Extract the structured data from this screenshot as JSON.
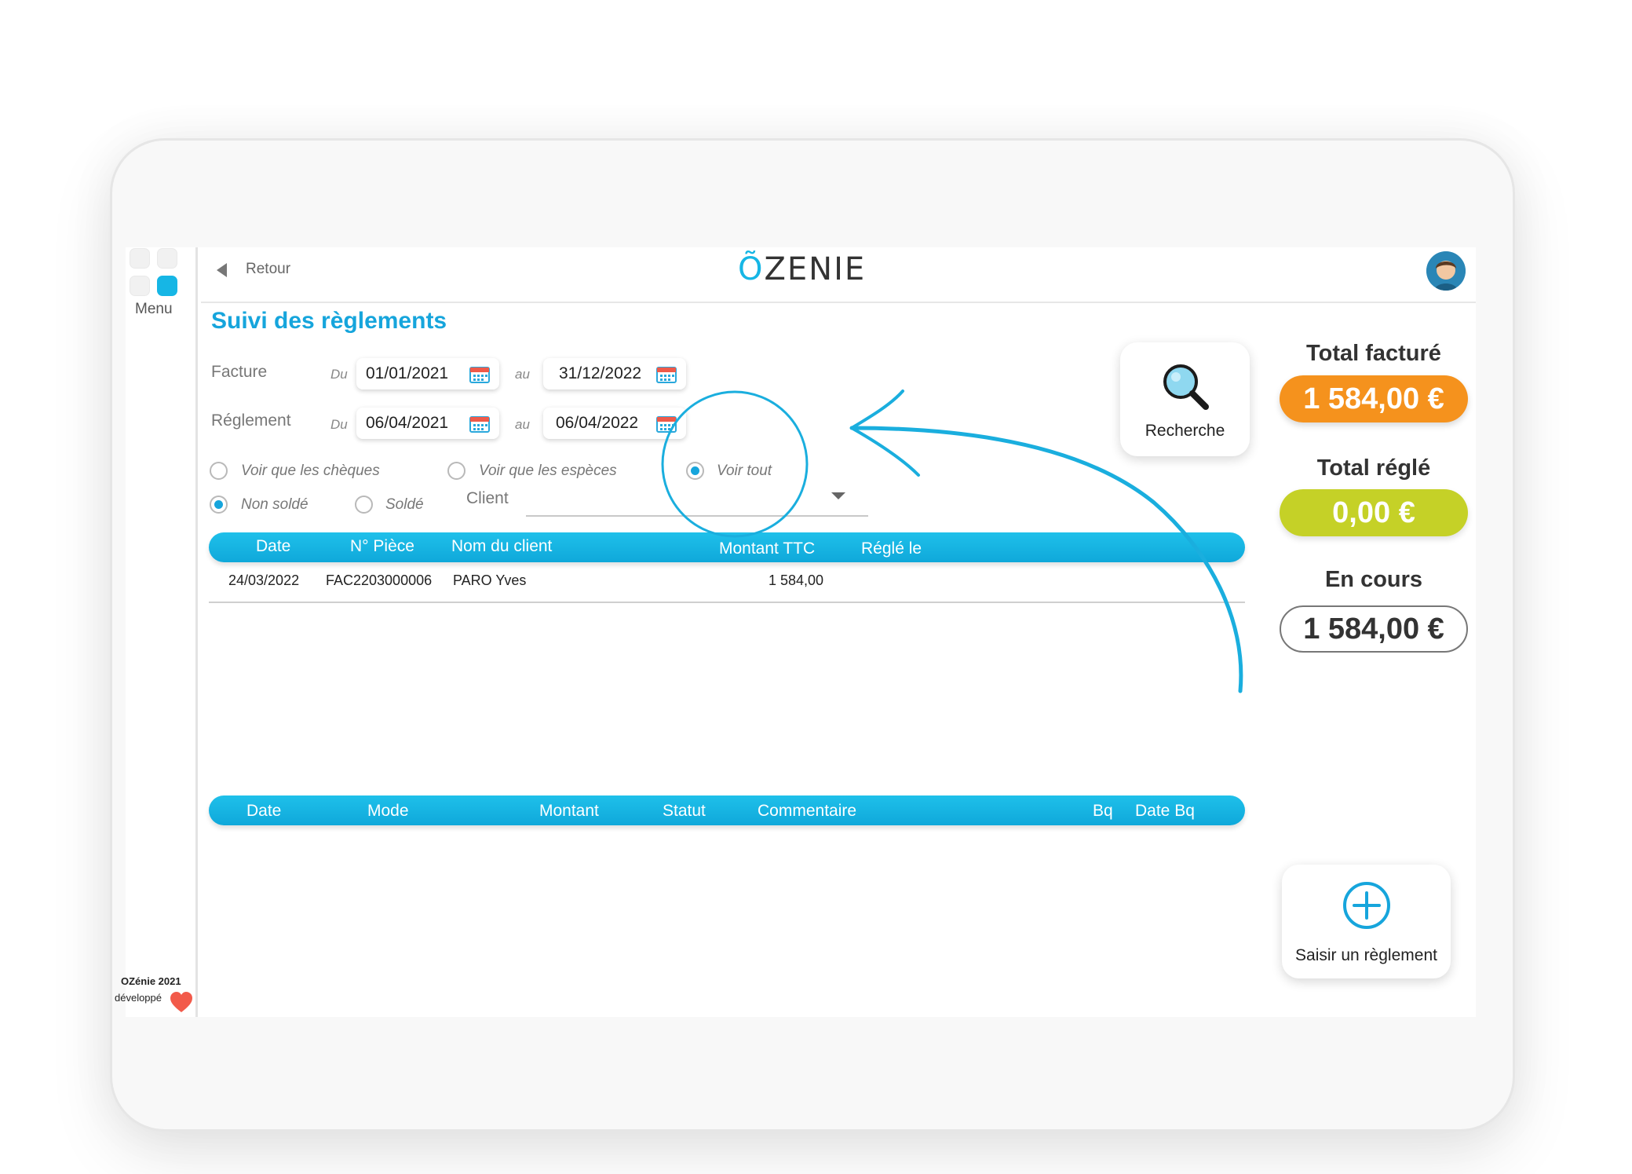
{
  "nav": {
    "menu_label": "Menu",
    "back_label": "Retour"
  },
  "brand": {
    "logo_text": "ZENIE",
    "footer_line1": "OZénie 2021",
    "footer_line2": "développé"
  },
  "page": {
    "title": "Suivi des règlements"
  },
  "filters": {
    "facture": {
      "label": "Facture",
      "du_label": "Du",
      "from": "01/01/2021",
      "au_label": "au",
      "to": "31/12/2022"
    },
    "reglement": {
      "label": "Réglement",
      "du_label": "Du",
      "from": "06/04/2021",
      "au_label": "au",
      "to": "06/04/2022"
    },
    "radios": {
      "cheques": "Voir que les chèques",
      "especes": "Voir que les espèces",
      "tout": "Voir tout",
      "non_solde": "Non soldé",
      "solde": "Soldé"
    },
    "client_label": "Client"
  },
  "invoices": {
    "headers": [
      "Date",
      "N° Pièce",
      "Nom du client",
      "Montant TTC",
      "Réglé le"
    ],
    "rows": [
      {
        "date": "24/03/2022",
        "piece": "FAC2203000006",
        "client": "PARO Yves",
        "montant": "1 584,00",
        "regle": ""
      }
    ]
  },
  "payments": {
    "headers": [
      "Date",
      "Mode",
      "Montant",
      "Statut",
      "Commentaire",
      "Bq",
      "Date Bq"
    ]
  },
  "search_button": {
    "label": "Recherche"
  },
  "totals": {
    "facture_label": "Total facturé",
    "facture_value": "1 584,00 €",
    "regle_label": "Total réglé",
    "regle_value": "0,00 €",
    "encours_label": "En cours",
    "encours_value": "1 584,00 €"
  },
  "add_button": {
    "label": "Saisir un règlement"
  },
  "colors": {
    "accent": "#16b6e5",
    "orange": "#f5921d",
    "green": "#c5d127"
  }
}
